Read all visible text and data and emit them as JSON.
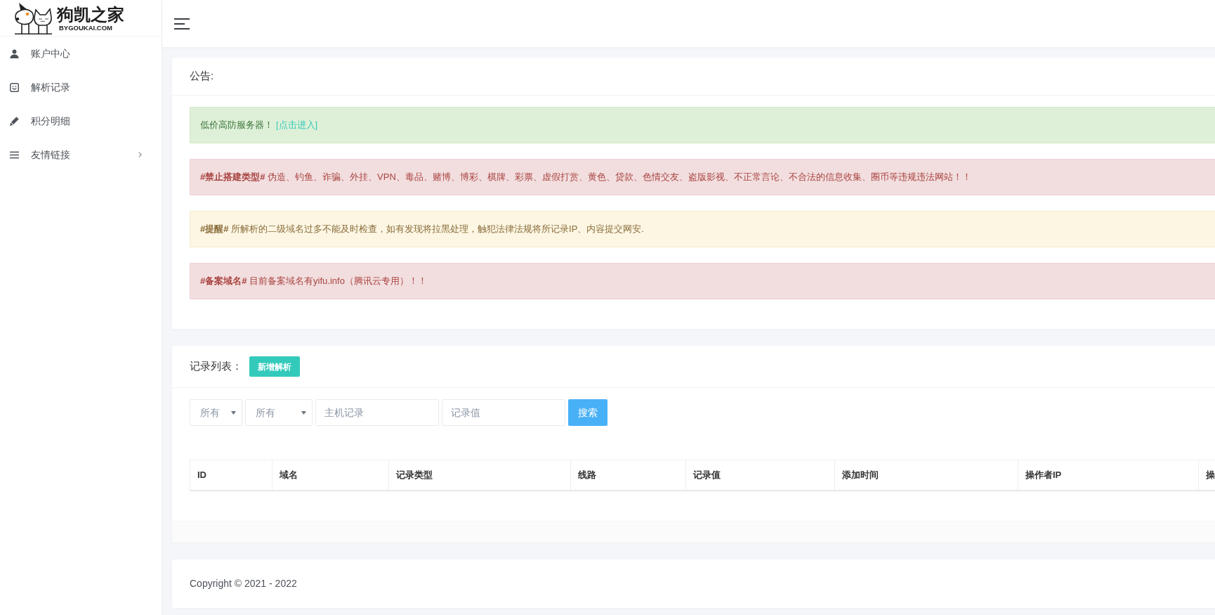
{
  "sidebar": {
    "logo": {
      "title": "狗凯之家",
      "subtitle": "BYGOUKAI.COM"
    },
    "items": [
      {
        "label": "账户中心",
        "kind": "link"
      },
      {
        "label": "解析记录",
        "kind": "link"
      },
      {
        "label": "积分明细",
        "kind": "link"
      },
      {
        "label": "友情链接",
        "kind": "submenu"
      }
    ]
  },
  "notice": {
    "title": "公告:",
    "alerts": [
      {
        "kind": "success",
        "text": "低价高防服务器！",
        "link": "[点击进入]"
      },
      {
        "kind": "danger",
        "text": "**#禁止搭建类型#** 伪造、钓鱼、诈骗、外挂、VPN、毒品、赌博、博彩、棋牌、彩票、虚假打赏、黄色、贷款、色情交友、盗版影视、不正常言论、不合法的信息收集、圈币等违规违法网站！！"
      },
      {
        "kind": "warning",
        "text": "**#提醒#** 所解析的二级域名过多不能及时检查，如有发现将拉黑处理，触犯法律法规将所记录IP、内容提交网安."
      },
      {
        "kind": "danger",
        "text": "**#备案域名#** 目前备案域名有yifu.info（腾讯云专用）！！"
      }
    ]
  },
  "records": {
    "title": "记录列表：",
    "add_button": "新增解析",
    "filters": [
      {
        "kind": "select",
        "value": "所有"
      },
      {
        "kind": "select",
        "value": "所有"
      },
      {
        "kind": "input",
        "placeholder": "主机记录"
      },
      {
        "kind": "input",
        "placeholder": "记录值"
      }
    ],
    "search_button": "搜索",
    "table": {
      "columns": [
        "ID",
        "域名",
        "记录类型",
        "线路",
        "记录值",
        "添加时间",
        "操作者IP",
        "操"
      ]
    }
  },
  "footer": {
    "copyright": "Copyright © 2021 - 2022"
  }
}
